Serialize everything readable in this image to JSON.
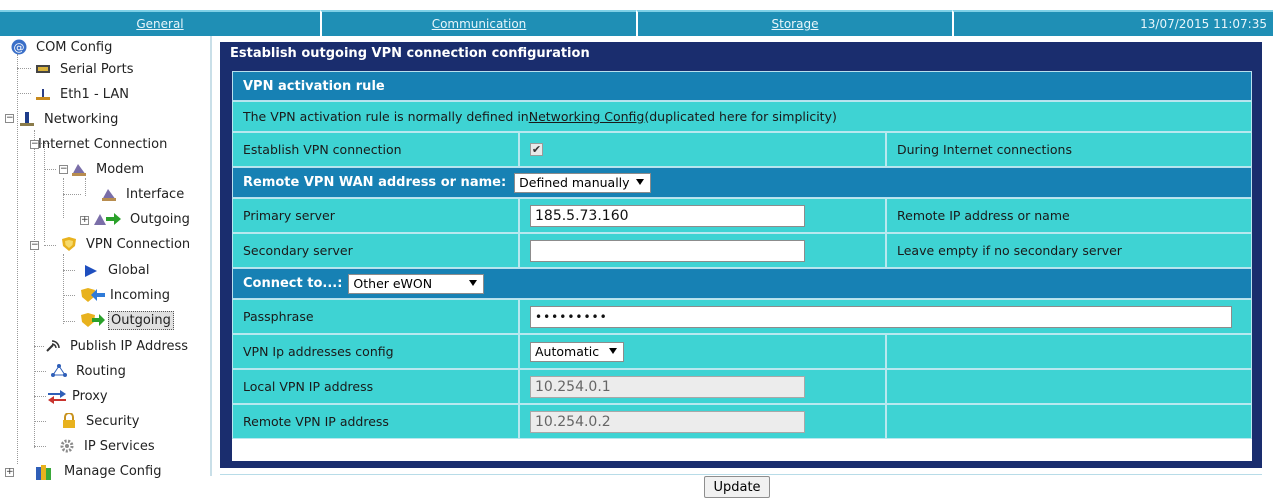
{
  "nav": {
    "general": "General",
    "communication": "Communication",
    "storage": "Storage",
    "datetime": "13/07/2015 11:07:35"
  },
  "tree": {
    "root": "COM Config",
    "serial": "Serial Ports",
    "eth1": "Eth1 - LAN",
    "networking": "Networking",
    "internet": "Internet Connection",
    "modem": "Modem",
    "interface": "Interface",
    "outgoing1": "Outgoing",
    "vpn": "VPN Connection",
    "global": "Global",
    "incoming": "Incoming",
    "outgoing2": "Outgoing",
    "publish": "Publish IP Address",
    "routing": "Routing",
    "proxy": "Proxy",
    "security": "Security",
    "ipservices": "IP Services",
    "manage": "Manage Config"
  },
  "panel": {
    "title": "Establish outgoing VPN connection configuration",
    "activation_header": "VPN activation rule",
    "activation_text_pre": "The VPN activation rule is normally defined in ",
    "activation_link": "Networking Config",
    "activation_text_post": " (duplicated here for simplicity)",
    "establish_label": "Establish VPN connection",
    "establish_checked": "✔",
    "establish_note": "During Internet connections",
    "remote_header": "Remote VPN WAN address or name:",
    "remote_select": "Defined manually",
    "primary_label": "Primary server",
    "primary_value": "185.5.73.160",
    "primary_note": "Remote IP address or name",
    "secondary_label": "Secondary server",
    "secondary_value": "",
    "secondary_note": "Leave empty if no secondary server",
    "connect_header": "Connect to...:",
    "connect_select": "Other eWON",
    "passphrase_label": "Passphrase",
    "passphrase_value": "•••••••••",
    "ipconfig_label": "VPN Ip addresses config",
    "ipconfig_select": "Automatic",
    "local_label": "Local VPN IP address",
    "local_value": "10.254.0.1",
    "remote_ip_label": "Remote VPN IP address",
    "remote_ip_value": "10.254.0.2"
  },
  "update_label": "Update"
}
